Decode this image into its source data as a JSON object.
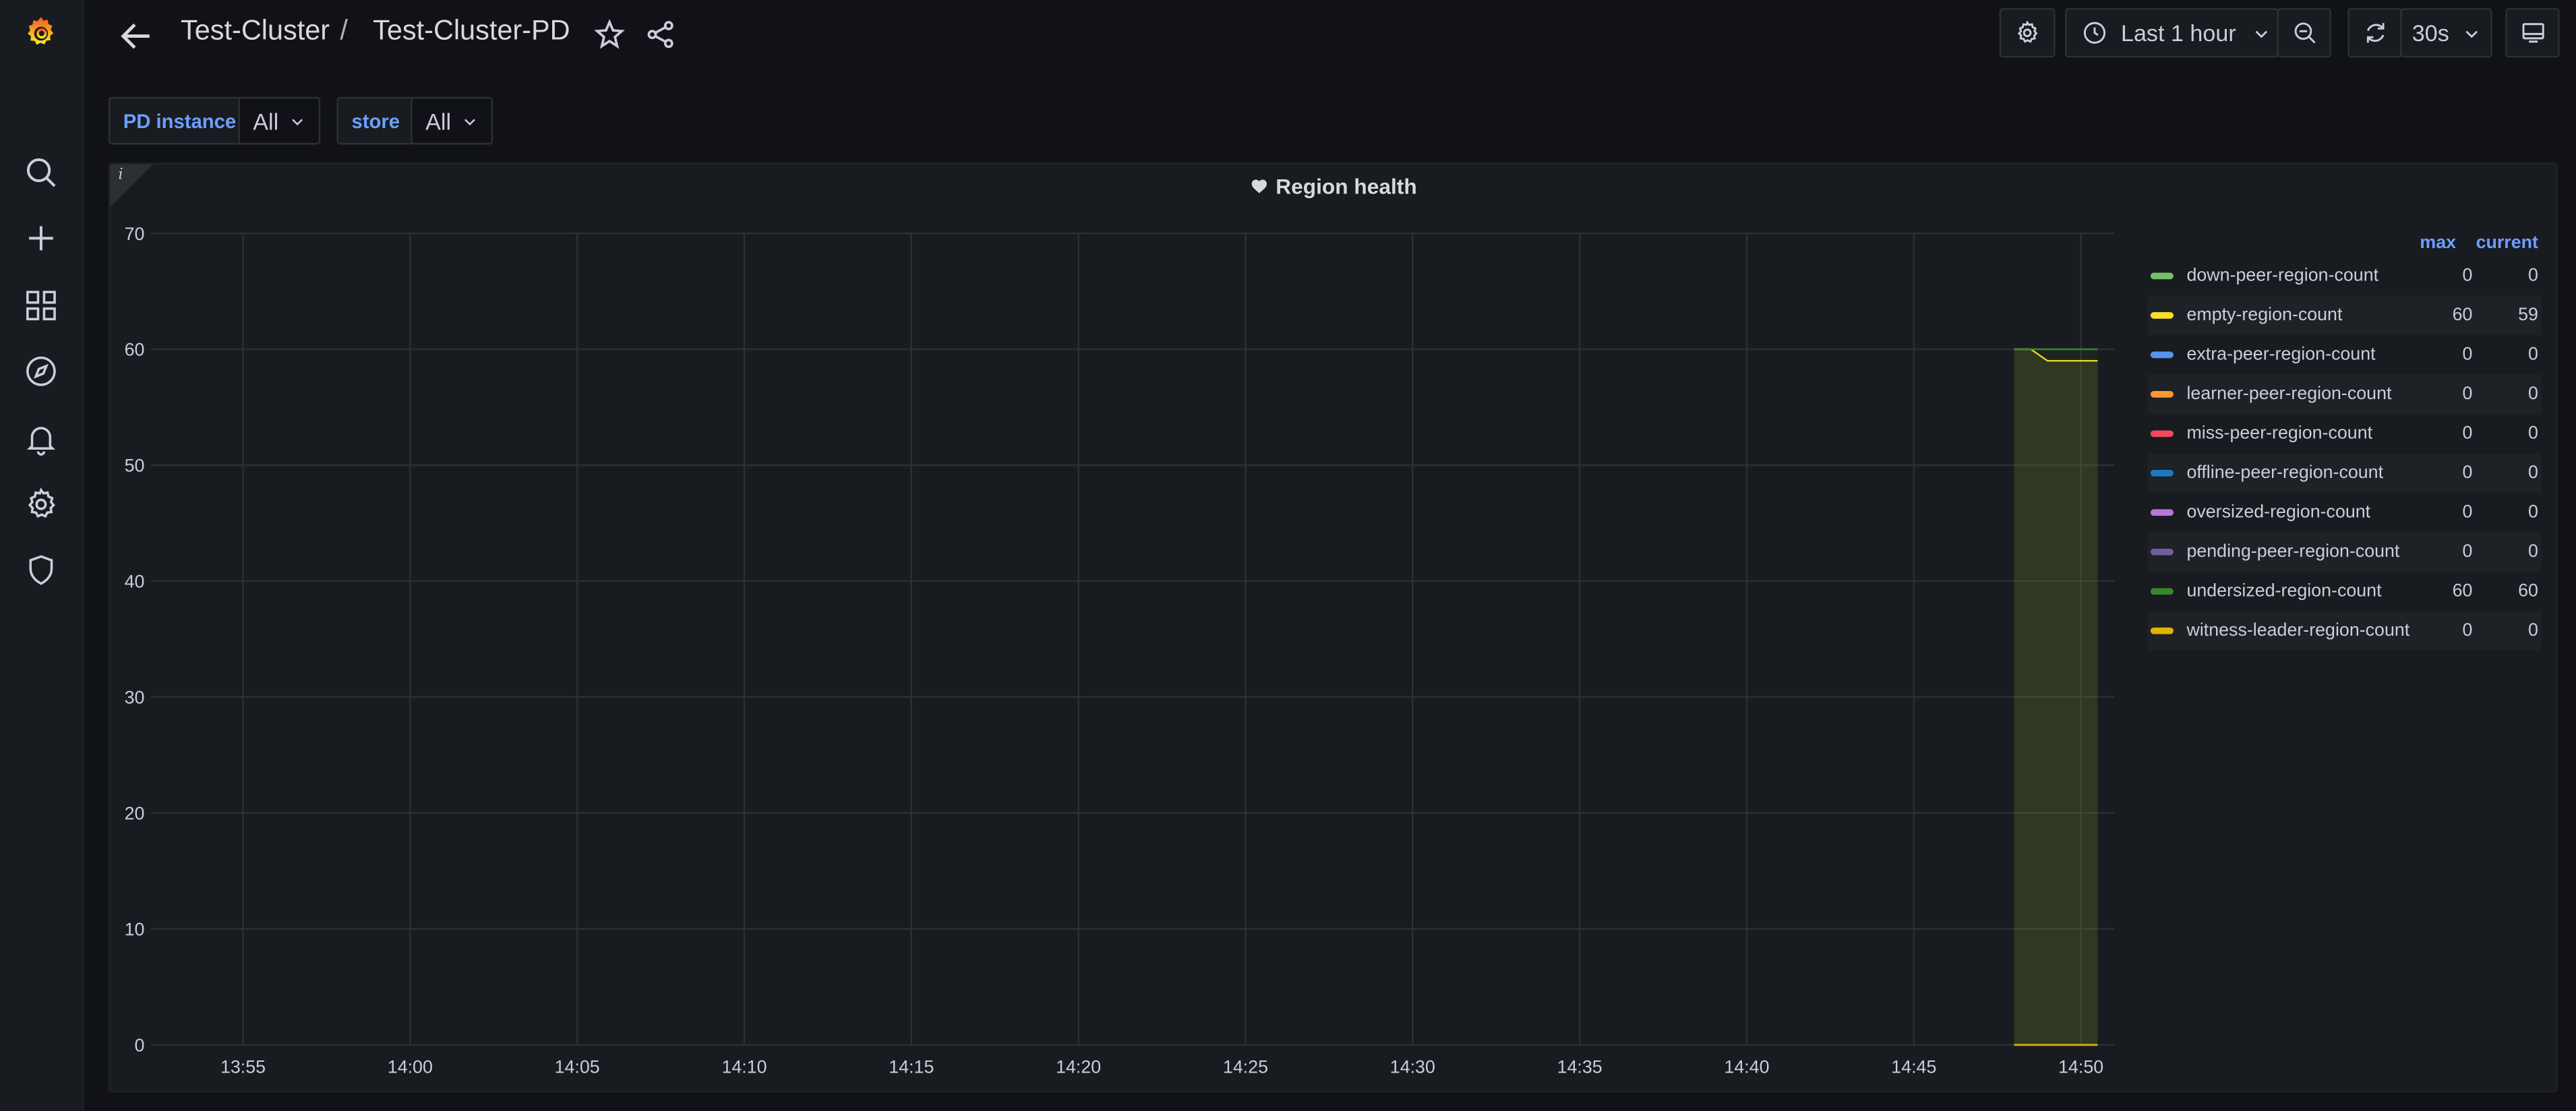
{
  "breadcrumb": {
    "folder": "Test-Cluster",
    "separator": "/",
    "dashboard": "Test-Cluster-PD"
  },
  "toolbar": {
    "time_range": "Last 1 hour",
    "refresh_interval": "30s"
  },
  "variables": [
    {
      "label": "PD instance",
      "value": "All"
    },
    {
      "label": "store",
      "value": "All"
    }
  ],
  "panel": {
    "title": "Region health",
    "info": "i"
  },
  "legend": {
    "col_max": "max",
    "col_current": "current"
  },
  "colors": {
    "accent": "#6e9fff",
    "brand": "#f05a28"
  },
  "chart_data": {
    "type": "line",
    "title": "Region health",
    "ylim": [
      0,
      70
    ],
    "yticks": [
      0,
      10,
      20,
      30,
      40,
      50,
      60,
      70
    ],
    "xticks": [
      "13:55",
      "14:00",
      "14:05",
      "14:10",
      "14:15",
      "14:20",
      "14:25",
      "14:30",
      "14:35",
      "14:40",
      "14:45",
      "14:50"
    ],
    "xlim": [
      "13:52:15",
      "14:51:00"
    ],
    "grid": true,
    "legend_placement": "right",
    "series": [
      {
        "name": "down-peer-region-count",
        "color": "#73bf69",
        "max": "0",
        "current": "0",
        "x": [
          "14:48:00",
          "14:50:30"
        ],
        "values": [
          0,
          0
        ]
      },
      {
        "name": "empty-region-count",
        "color": "#fade2a",
        "max": "60",
        "current": "59",
        "x": [
          "14:48:00",
          "14:48:30",
          "14:49:00",
          "14:50:30"
        ],
        "values": [
          60,
          60,
          59,
          59
        ]
      },
      {
        "name": "extra-peer-region-count",
        "color": "#5794f2",
        "max": "0",
        "current": "0",
        "x": [
          "14:48:00",
          "14:50:30"
        ],
        "values": [
          0,
          0
        ]
      },
      {
        "name": "learner-peer-region-count",
        "color": "#ff9830",
        "max": "0",
        "current": "0",
        "x": [
          "14:48:00",
          "14:50:30"
        ],
        "values": [
          0,
          0
        ]
      },
      {
        "name": "miss-peer-region-count",
        "color": "#f2495c",
        "max": "0",
        "current": "0",
        "x": [
          "14:48:00",
          "14:50:30"
        ],
        "values": [
          0,
          0
        ]
      },
      {
        "name": "offline-peer-region-count",
        "color": "#1f78c1",
        "max": "0",
        "current": "0",
        "x": [
          "14:48:00",
          "14:50:30"
        ],
        "values": [
          0,
          0
        ]
      },
      {
        "name": "oversized-region-count",
        "color": "#b877d9",
        "max": "0",
        "current": "0",
        "x": [
          "14:48:00",
          "14:50:30"
        ],
        "values": [
          0,
          0
        ]
      },
      {
        "name": "pending-peer-region-count",
        "color": "#705da0",
        "max": "0",
        "current": "0",
        "x": [
          "14:48:00",
          "14:50:30"
        ],
        "values": [
          0,
          0
        ]
      },
      {
        "name": "undersized-region-count",
        "color": "#37872d",
        "max": "60",
        "current": "60",
        "x": [
          "14:48:00",
          "14:50:30"
        ],
        "values": [
          60,
          60
        ]
      },
      {
        "name": "witness-leader-region-count",
        "color": "#e0b400",
        "max": "0",
        "current": "0",
        "x": [
          "14:48:00",
          "14:50:30"
        ],
        "values": [
          0,
          0
        ]
      }
    ]
  }
}
